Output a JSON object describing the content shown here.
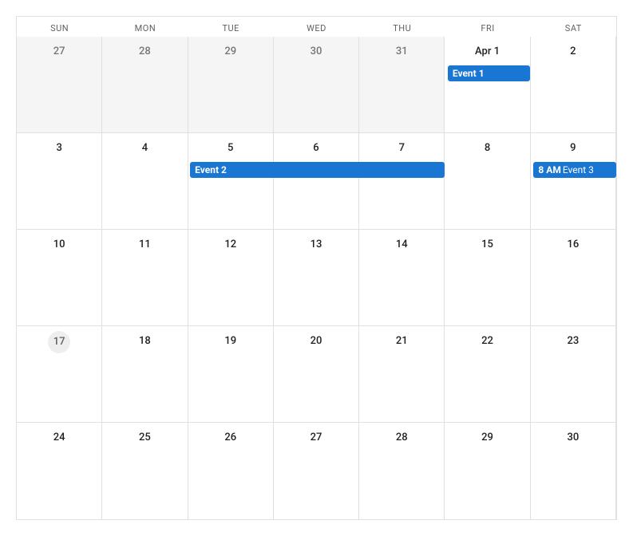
{
  "dayHeaders": [
    "SUN",
    "MON",
    "TUE",
    "WED",
    "THU",
    "FRI",
    "SAT"
  ],
  "weeks": [
    [
      {
        "label": "27",
        "other": true
      },
      {
        "label": "28",
        "other": true
      },
      {
        "label": "29",
        "other": true
      },
      {
        "label": "30",
        "other": true
      },
      {
        "label": "31",
        "other": true
      },
      {
        "label": "Apr 1",
        "monthStart": true
      },
      {
        "label": "2"
      }
    ],
    [
      {
        "label": "3"
      },
      {
        "label": "4"
      },
      {
        "label": "5"
      },
      {
        "label": "6"
      },
      {
        "label": "7"
      },
      {
        "label": "8"
      },
      {
        "label": "9"
      }
    ],
    [
      {
        "label": "10"
      },
      {
        "label": "11"
      },
      {
        "label": "12"
      },
      {
        "label": "13"
      },
      {
        "label": "14"
      },
      {
        "label": "15"
      },
      {
        "label": "16"
      }
    ],
    [
      {
        "label": "17",
        "today": true
      },
      {
        "label": "18"
      },
      {
        "label": "19"
      },
      {
        "label": "20"
      },
      {
        "label": "21"
      },
      {
        "label": "22"
      },
      {
        "label": "23"
      }
    ],
    [
      {
        "label": "24"
      },
      {
        "label": "25"
      },
      {
        "label": "26"
      },
      {
        "label": "27"
      },
      {
        "label": "28"
      },
      {
        "label": "29"
      },
      {
        "label": "30"
      }
    ]
  ],
  "events": [
    {
      "week": 0,
      "startCol": 5,
      "span": 1,
      "title": "Event 1",
      "time": "",
      "bold": true
    },
    {
      "week": 1,
      "startCol": 2,
      "span": 3,
      "title": "Event 2",
      "time": "",
      "bold": true
    },
    {
      "week": 1,
      "startCol": 6,
      "span": 1,
      "title": "Event 3",
      "time": "8 AM",
      "bold": false
    }
  ],
  "colors": {
    "event_bg": "#1976d2"
  }
}
